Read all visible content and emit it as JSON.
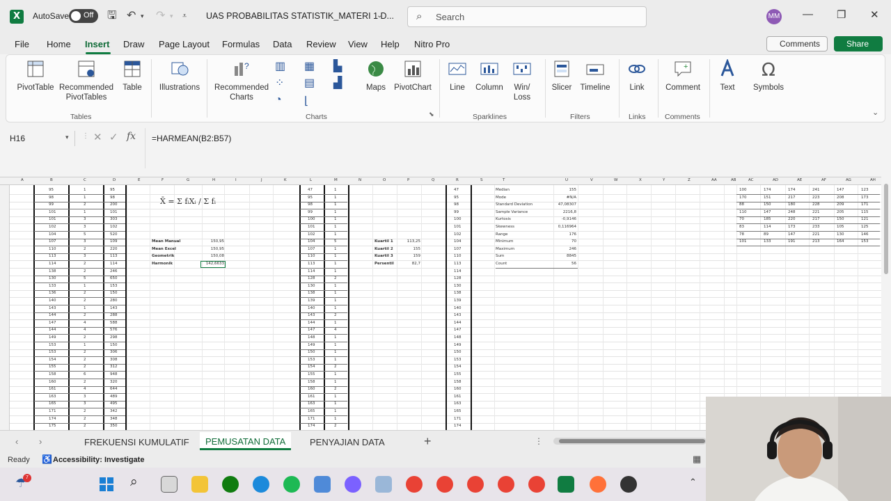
{
  "titlebar": {
    "autosave_label": "AutoSave",
    "autosave_state": "Off",
    "document_title": "UAS PROBABILITAS STATISTIK_MATERI 1 D...",
    "search_placeholder": "Search",
    "user_initials": "MM"
  },
  "menu": {
    "tabs": [
      "File",
      "Home",
      "Insert",
      "Draw",
      "Page Layout",
      "Formulas",
      "Data",
      "Review",
      "View",
      "Help",
      "Nitro Pro"
    ],
    "active": "Insert",
    "comments_label": "Comments",
    "share_label": "Share"
  },
  "ribbon": {
    "buttons": {
      "pivottable": "PivotTable",
      "recommended_pivottables": "Recommended PivotTables",
      "table": "Table",
      "illustrations": "Illustrations",
      "recommended_charts": "Recommended Charts",
      "maps": "Maps",
      "pivotchart": "PivotChart",
      "line": "Line",
      "column": "Column",
      "win_loss": "Win/ Loss",
      "slicer": "Slicer",
      "timeline": "Timeline",
      "link": "Link",
      "comment": "Comment",
      "text": "Text",
      "symbols": "Symbols"
    },
    "groups": {
      "tables": "Tables",
      "charts": "Charts",
      "sparklines": "Sparklines",
      "filters": "Filters",
      "links": "Links",
      "comments": "Comments"
    }
  },
  "formula_bar": {
    "name_box": "H16",
    "formula": "=HARMEAN(B2:B57)"
  },
  "sheet": {
    "column_letters_left": [
      "A",
      "B",
      "C",
      "D",
      "E",
      "F",
      "G",
      "H",
      "I",
      "J",
      "K",
      "L",
      "M",
      "N",
      "O",
      "P",
      "Q",
      "R",
      "S",
      "T",
      "U",
      "V",
      "W",
      "X",
      "Y",
      "Z",
      "AA",
      "AB",
      "AC",
      "AD",
      "AE",
      "AF",
      "AG",
      "AH"
    ],
    "table1_col1": [
      "95",
      "98",
      "99",
      "101",
      "101",
      "102",
      "104",
      "107",
      "110",
      "113",
      "114",
      "138",
      "130",
      "133",
      "136",
      "140",
      "143",
      "144",
      "147",
      "144",
      "149",
      "153",
      "153",
      "154",
      "155",
      "158",
      "160",
      "161",
      "163",
      "165",
      "171",
      "174",
      "175"
    ],
    "table1_col2": [
      "1",
      "1",
      "2",
      "1",
      "3",
      "3",
      "5",
      "3",
      "2",
      "3",
      "2",
      "2",
      "5",
      "1",
      "2",
      "2",
      "1",
      "2",
      "4",
      "4",
      "2",
      "1",
      "2",
      "2",
      "2",
      "6",
      "2",
      "4",
      "3",
      "3",
      "2",
      "2",
      "2"
    ],
    "table1_col3": [
      "95",
      "98",
      "200",
      "101",
      "303",
      "102",
      "520",
      "109",
      "220",
      "113",
      "114",
      "246",
      "650",
      "153",
      "150",
      "280",
      "143",
      "288",
      "588",
      "576",
      "298",
      "150",
      "306",
      "308",
      "312",
      "948",
      "320",
      "644",
      "489",
      "495",
      "342",
      "348",
      "350"
    ],
    "formula_label": "X̄ = Σ fᵢXᵢ / Σ fᵢ",
    "mean_labels": [
      "Mean Manual",
      "Mean Excel",
      "Geometrik",
      "Harmonik"
    ],
    "mean_values": [
      "150,95",
      "150,95",
      "150,08",
      "142,6633"
    ],
    "table2_col1": [
      "47",
      "95",
      "98",
      "99",
      "100",
      "101",
      "102",
      "104",
      "107",
      "110",
      "113",
      "114",
      "128",
      "130",
      "138",
      "139",
      "140",
      "143",
      "144",
      "147",
      "148",
      "149",
      "150",
      "153",
      "154",
      "155",
      "158",
      "160",
      "161",
      "163",
      "165",
      "171",
      "174"
    ],
    "table2_col2": [
      "1",
      "1",
      "1",
      "1",
      "1",
      "1",
      "1",
      "5",
      "1",
      "1",
      "1",
      "1",
      "2",
      "1",
      "1",
      "1",
      "1",
      "2",
      "1",
      "4",
      "1",
      "1",
      "1",
      "1",
      "2",
      "1",
      "1",
      "2",
      "1",
      "1",
      "1",
      "1",
      "2"
    ],
    "quartile_labels": [
      "Kuartil 1",
      "Kuartil 2",
      "Kuartil 3",
      "Persentil"
    ],
    "quartile_values": [
      "113,25",
      "155",
      "159",
      "82,7"
    ],
    "sorted_list": [
      "47",
      "95",
      "98",
      "99",
      "100",
      "101",
      "102",
      "104",
      "107",
      "110",
      "113",
      "114",
      "128",
      "130",
      "138",
      "139",
      "140",
      "143",
      "144",
      "147",
      "148",
      "149",
      "150",
      "153",
      "154",
      "155",
      "158",
      "160",
      "161",
      "163",
      "165",
      "171",
      "174"
    ],
    "stats_labels": [
      "Median",
      "Mode",
      "Standard Deviation",
      "Sample Variance",
      "Kurtosis",
      "Skewness",
      "Range",
      "Minimum",
      "Maximum",
      "Sum",
      "Count"
    ],
    "stats_values": [
      "155",
      "#N/A",
      "47,08307",
      "2216,8",
      "-0,9146",
      "0,116964",
      "176",
      "70",
      "246",
      "8845",
      "56"
    ],
    "data_block": [
      [
        "100",
        "174",
        "174",
        "241",
        "147",
        "123"
      ],
      [
        "170",
        "151",
        "217",
        "223",
        "208",
        "173"
      ],
      [
        "88",
        "150",
        "180",
        "228",
        "209",
        "171"
      ],
      [
        "110",
        "147",
        "248",
        "221",
        "205",
        "115"
      ],
      [
        "70",
        "185",
        "220",
        "217",
        "150",
        "121"
      ],
      [
        "83",
        "114",
        "173",
        "233",
        "105",
        "125"
      ],
      [
        "78",
        "89",
        "147",
        "221",
        "130",
        "146"
      ],
      [
        "101",
        "133",
        "191",
        "213",
        "164",
        "153"
      ]
    ]
  },
  "sheet_tabs": {
    "tabs": [
      "FREKUENSI KUMULATIF",
      "PEMUSATAN DATA",
      "PENYAJIAN DATA"
    ],
    "active": "PEMUSATAN DATA"
  },
  "status": {
    "ready": "Ready",
    "accessibility": "Accessibility: Investigate"
  },
  "colors": {
    "excel_green": "#107c41",
    "accent_dark_green": "#0f6b37"
  }
}
